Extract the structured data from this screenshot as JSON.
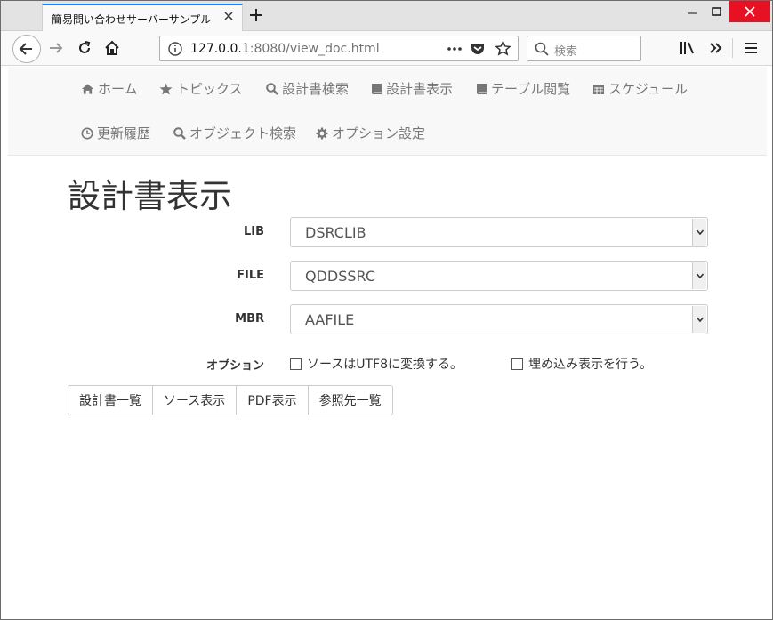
{
  "browser": {
    "tab_title": "簡易問い合わせサーバーサンプル",
    "url_host": "127.0.0.1",
    "url_rest": ":8080/view_doc.html",
    "search_placeholder": "検索"
  },
  "nav": {
    "items": [
      {
        "label": "ホーム",
        "icon": "home-icon"
      },
      {
        "label": "トピックス",
        "icon": "star-icon"
      },
      {
        "label": "設計書検索",
        "icon": "search-icon"
      },
      {
        "label": "設計書表示",
        "icon": "book-icon"
      },
      {
        "label": "テーブル閲覧",
        "icon": "book-icon"
      },
      {
        "label": "スケジュール",
        "icon": "calendar-icon"
      },
      {
        "label": "更新履歴",
        "icon": "clock-icon"
      },
      {
        "label": "オブジェクト検索",
        "icon": "search-icon"
      },
      {
        "label": "オプション設定",
        "icon": "gear-icon"
      }
    ]
  },
  "main": {
    "title": "設計書表示",
    "fields": [
      {
        "label": "LIB",
        "value": "DSRCLIB"
      },
      {
        "label": "FILE",
        "value": "QDDSSRC"
      },
      {
        "label": "MBR",
        "value": "AAFILE"
      }
    ],
    "options": {
      "label": "オプション",
      "checkboxes": [
        {
          "label": "ソースはUTF8に変換する。",
          "checked": false
        },
        {
          "label": "埋め込み表示を行う。",
          "checked": false
        }
      ]
    },
    "buttons": [
      "設計書一覧",
      "ソース表示",
      "PDF表示",
      "参照先一覧"
    ]
  }
}
